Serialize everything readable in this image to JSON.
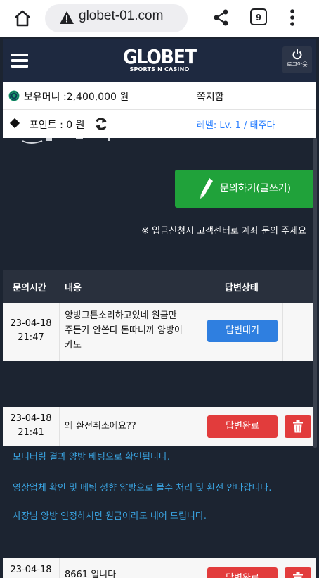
{
  "browser": {
    "url": "globet-01.com",
    "tab_count": "9",
    "icons": [
      "home-icon",
      "warning-icon",
      "share-icon",
      "tabs-icon",
      "menu-icon"
    ]
  },
  "header": {
    "logo_title": "GLOBET",
    "logo_subtitle": "SPORTS N CASINO",
    "logout_label": "로그아웃"
  },
  "info": {
    "money": "보유머니 :2,400,000 원",
    "messages": "쪽지함",
    "points": "포인트 :  0 원",
    "level": "레벨: Lv. 1 / 태주다"
  },
  "inquiry": {
    "write_button": "문의하기(글쓰기)",
    "notice": "※ 입금신청시 고객센터로 계좌 문의 주세요"
  },
  "table": {
    "headers": [
      "문의시간",
      "내용",
      "답변상태"
    ],
    "rows": [
      {
        "date": "23-04-18",
        "time": "21:47",
        "lines": [
          "양방그튼소리하고있네 원금만",
          "주든가 안쓴다 돈따니까 양방이",
          "카노"
        ],
        "status": "답변대기"
      },
      {
        "date": "23-04-18",
        "time": "21:41",
        "lines": [
          "왜 환전취소에요??"
        ],
        "status": "답변완료"
      },
      {
        "date": "23-04-18",
        "time": "",
        "lines": [
          "8661 입니다"
        ],
        "status": "답변완료"
      }
    ]
  },
  "reply": {
    "lines": [
      "모니터링 결과 양방 베팅으로 확인됩니다.",
      "영상업체 확인 및 베팅 성향 양방으로 몰수 처리 및 환전 안나갑니다.",
      "사장님 양방 인정하시면 원금이라도 내어 드립니다."
    ]
  },
  "colors": {
    "header_bg": "#1e2940",
    "content_bg": "#1c2431",
    "green": "#20a23a",
    "blue": "#2f7fe0",
    "red": "#e23c3c",
    "reply_text": "#3aa3e0",
    "level_text": "#2a7fff"
  }
}
